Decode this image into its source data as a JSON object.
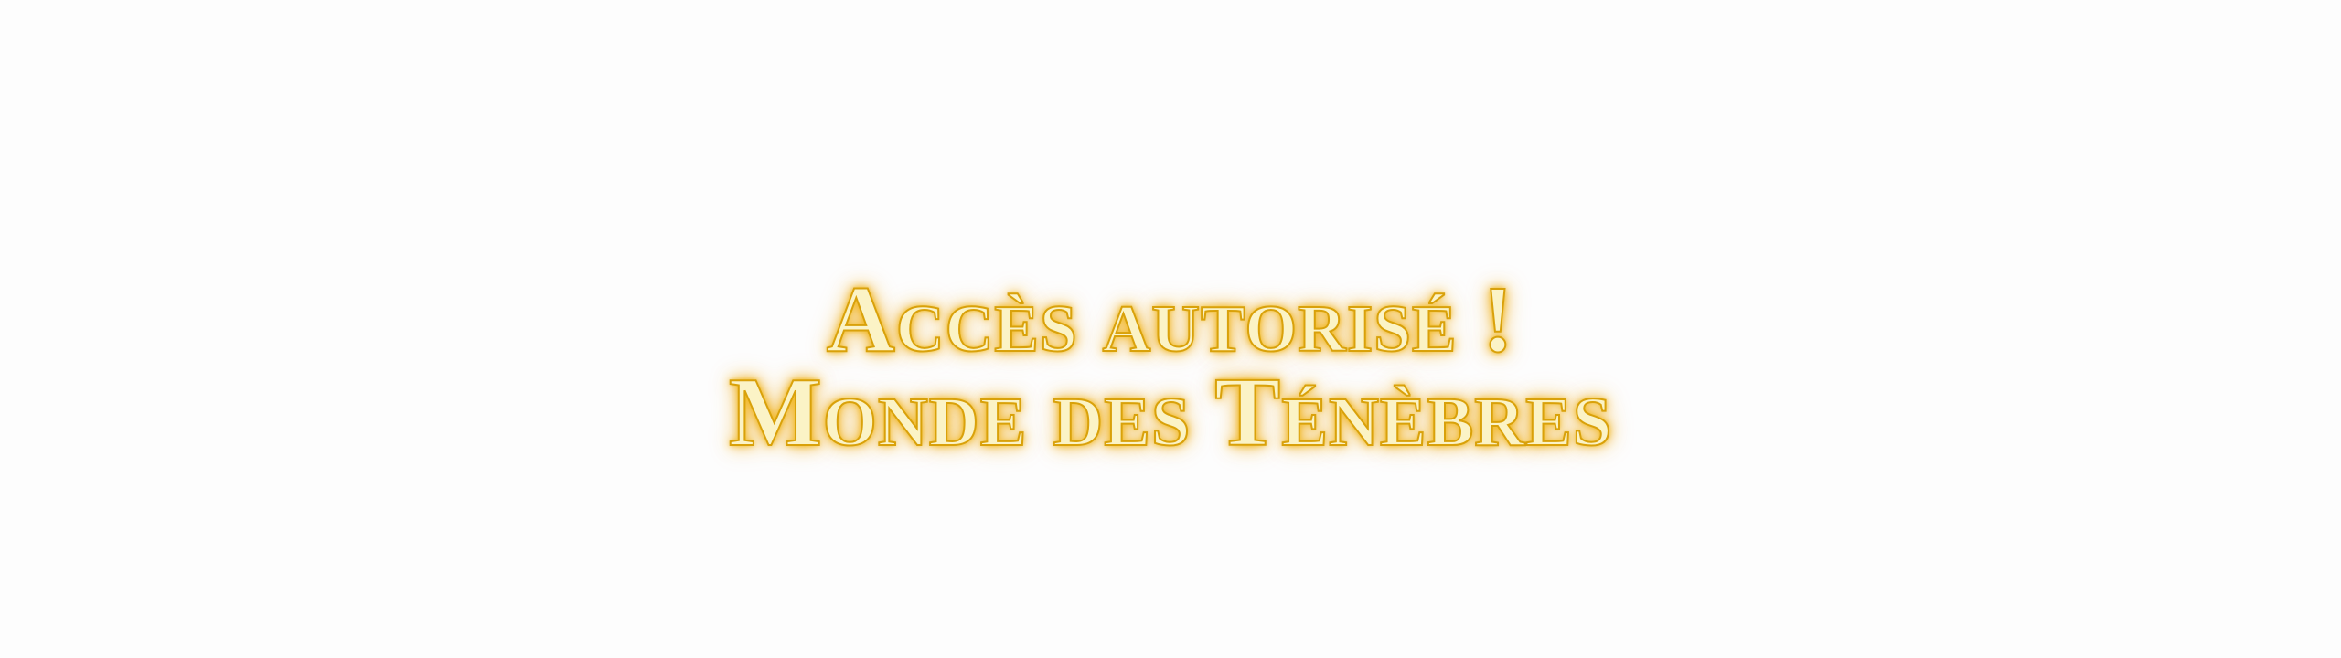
{
  "banner": {
    "line_1": "Accès autorisé !",
    "line_2": "Monde des Ténèbres"
  },
  "colors": {
    "text_fill": "#fbf3c6",
    "text_outline": "#d9a10a",
    "glow": "#f0b21a",
    "background": "#fdfdfd"
  }
}
